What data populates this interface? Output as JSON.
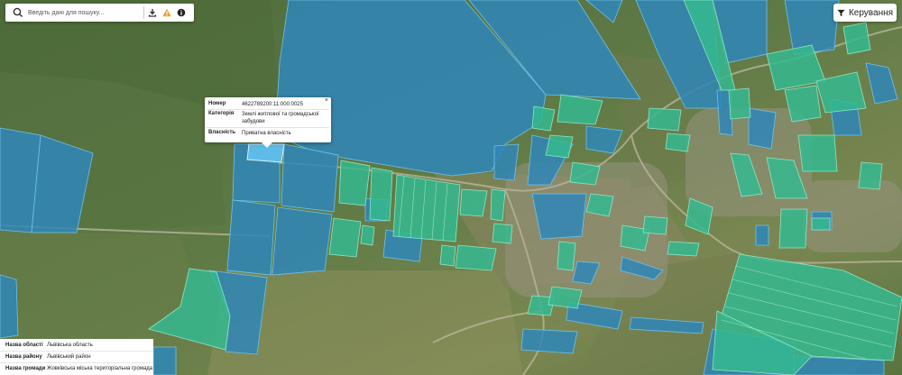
{
  "search": {
    "placeholder": "Введіть дані для пошуку...",
    "download_icon": "download-icon",
    "warning_icon": "warning-icon",
    "info_icon": "info-icon",
    "warning_color": "#f0a030"
  },
  "controls": {
    "manage_label": "Керування",
    "manage_icon": "filter-icon"
  },
  "popup": {
    "number_label": "Номер",
    "number_value": "4622789200:11:000:0025",
    "category_label": "Категорія",
    "category_value": "Землі житлової та громадської забудови",
    "ownership_label": "Власність",
    "ownership_value": "Приватна власність",
    "close_icon": "close-icon"
  },
  "admin_info": {
    "rows": [
      {
        "label": "Назва області",
        "value": "Львівська область"
      },
      {
        "label": "Назва району",
        "value": "Львівський район"
      },
      {
        "label": "Назва громади",
        "value": "Жовківська міська територіальна громада"
      }
    ]
  },
  "colors": {
    "parcel_blue": "#3a8fc2",
    "parcel_green": "#3cc2a0",
    "selected": "#5ec0f0"
  }
}
